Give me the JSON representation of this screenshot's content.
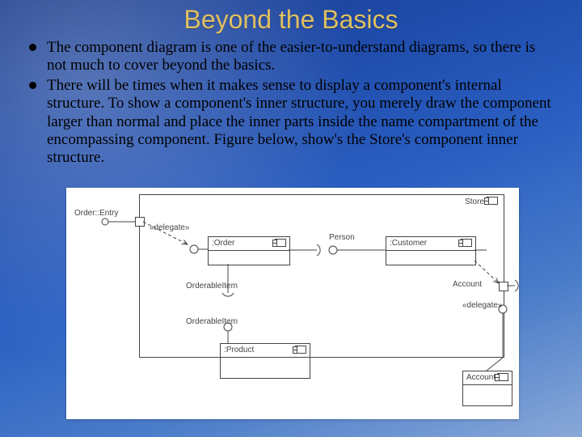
{
  "title": "Beyond the Basics",
  "bullets": [
    "The component diagram is one of the easier-to-understand diagrams, so there is not much to cover beyond the basics.",
    "There will be times when it makes sense to display a component's internal structure. To show a component's inner structure, you merely draw the component larger than normal and place the inner parts inside the name compartment of the encompassing component. Figure below, show's the Store's component inner structure."
  ],
  "diagram": {
    "outer": "Store",
    "portOrderEntry": "Order::Entry",
    "delegate1": "«delegate»",
    "delegate2": "«delegate»",
    "person": "Person",
    "orderObj": ":Order",
    "customerObj": ":Customer",
    "orderableItem": "OrderableItem",
    "orderableItem2": "OrderableItem",
    "account": "Account",
    "account2": "Account",
    "productObj": ":Product"
  }
}
